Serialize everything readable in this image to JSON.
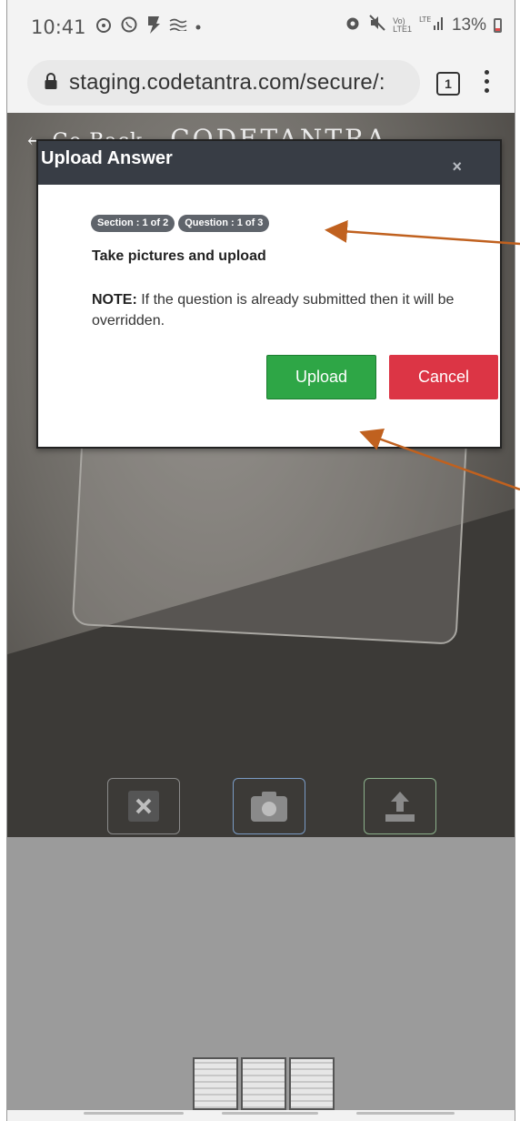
{
  "status_bar": {
    "time": "10:41",
    "battery": "13%",
    "icons_left": [
      "alarm-icon",
      "whatsapp-icon",
      "app-icon",
      "notification-icon",
      "dot-icon"
    ],
    "icons_right": [
      "alarm-icon",
      "mute-icon",
      "volte-icon",
      "lte-signal-icon",
      "battery-icon"
    ]
  },
  "browser": {
    "url": "staging.codetantra.com/secure/:",
    "tab_count": "1"
  },
  "page": {
    "go_back": "Go Back",
    "logo": "CODETANTRA"
  },
  "modal": {
    "title": "Upload Answer",
    "close": "×",
    "section_badge": "Section : 1 of 2",
    "question_badge": "Question : 1 of 3",
    "heading": "Take pictures and upload",
    "note_label": "NOTE:",
    "note_text": "If the question is already submitted then it will be overridden.",
    "upload_label": "Upload",
    "cancel_label": "Cancel"
  },
  "colors": {
    "modal_header": "#383d45",
    "upload_button": "#2ea646",
    "cancel_button": "#dc3545",
    "badge": "#5f646b",
    "annotation_arrow": "#c0611f"
  }
}
